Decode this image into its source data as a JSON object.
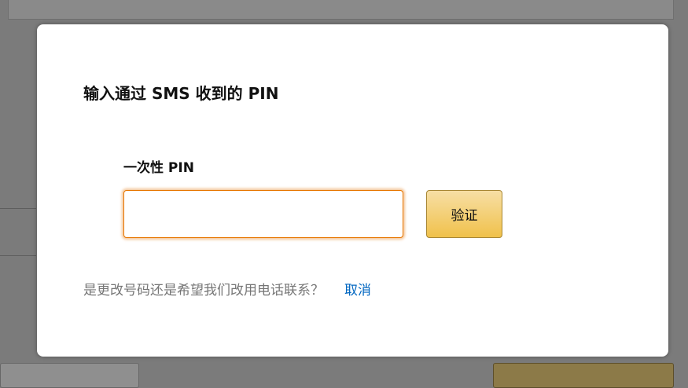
{
  "colors": {
    "overlay": "#7b7b7b",
    "modal_background": "#ffffff",
    "input_focus_border": "#e77600",
    "button_gradient_top": "#f7dfa5",
    "button_gradient_bottom": "#f0c14b",
    "link": "#0066c0",
    "muted_text": "#767676"
  },
  "dialog": {
    "title": "输入通过 SMS 收到的 PIN",
    "pin_field": {
      "label": "一次性 PIN",
      "value": "",
      "focused": true
    },
    "verify_button_label": "验证",
    "help_text": "是更改号码还是希望我们改用电话联系？",
    "cancel_link_label": "取消"
  }
}
